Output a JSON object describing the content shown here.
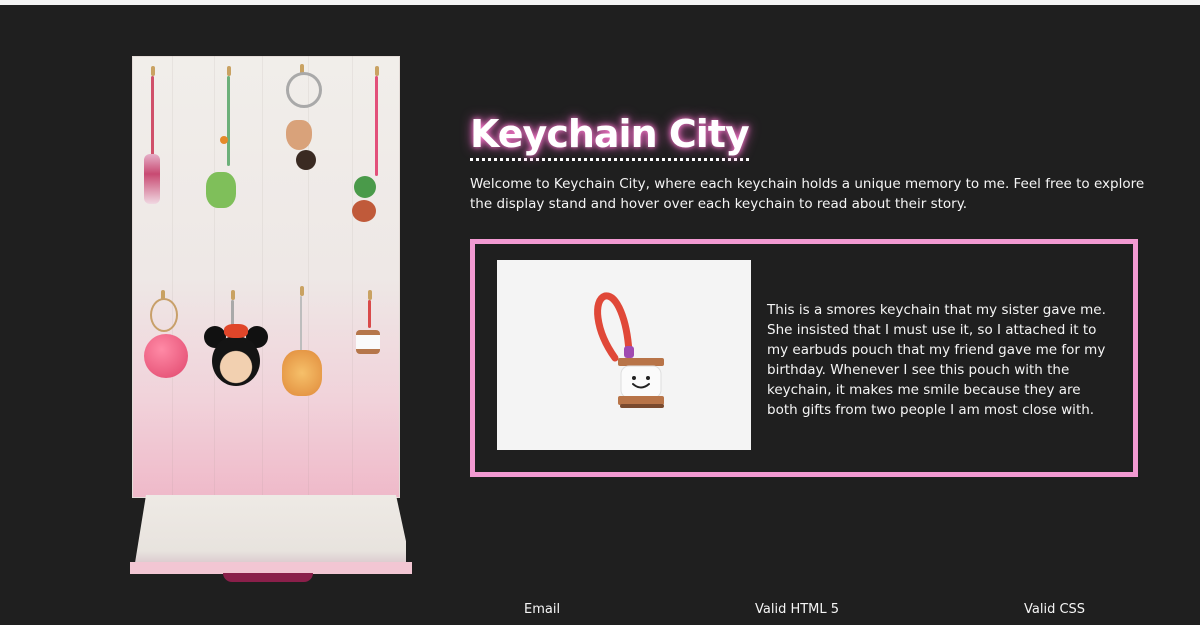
{
  "header": {
    "title": "Keychain City",
    "intro": "Welcome to Keychain City, where each keychain holds a unique memory to me. Feel free to explore the display stand and hover over each keychain to read about their story."
  },
  "featured": {
    "story": "This is a smores keychain that my sister gave me. She insisted that I must use it, so I attached it to my earbuds pouch that my friend gave me for my birthday. Whenever I see this pouch with the keychain, it makes me smile because they are both gifts from two people I am most close with.",
    "image_subject": "smores-keychain"
  },
  "stand": {
    "keychains": [
      "beaded-strap-keychain",
      "frog-keychain",
      "heart-ring-keychain",
      "strawberry-keychain",
      "macaron-keychain",
      "minnie-mouse-keychain",
      "beaded-deer-keychain",
      "mini-smores-keychain"
    ]
  },
  "footer": {
    "email": "Email",
    "html": "Valid HTML 5",
    "css": "Valid CSS"
  },
  "colors": {
    "background": "#1f1f1f",
    "accent_border": "#f29ad2",
    "title_glow": "#ff7dd0"
  }
}
